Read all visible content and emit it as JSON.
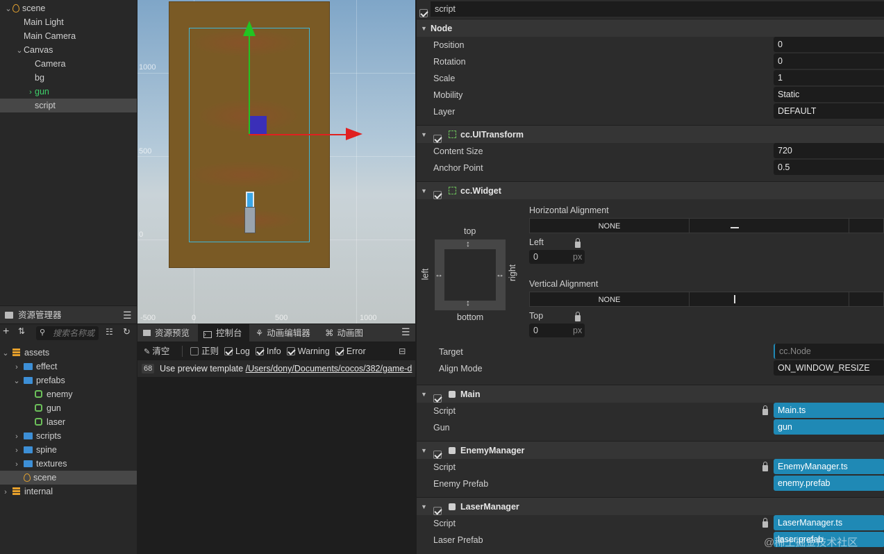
{
  "hierarchy": {
    "items": [
      {
        "label": "scene",
        "indent": 0,
        "arrow": "⌄",
        "icon": "fire"
      },
      {
        "label": "Main Light",
        "indent": 1,
        "arrow": "",
        "icon": ""
      },
      {
        "label": "Main Camera",
        "indent": 1,
        "arrow": "",
        "icon": ""
      },
      {
        "label": "Canvas",
        "indent": 1,
        "arrow": "⌄",
        "icon": ""
      },
      {
        "label": "Camera",
        "indent": 2,
        "arrow": "",
        "icon": ""
      },
      {
        "label": "bg",
        "indent": 2,
        "arrow": "",
        "icon": ""
      },
      {
        "label": "gun",
        "indent": 2,
        "arrow": "›",
        "icon": "",
        "color": "#3fcf6a"
      },
      {
        "label": "script",
        "indent": 2,
        "arrow": "",
        "icon": "",
        "selected": true
      }
    ]
  },
  "scene": {
    "ruler_left": [
      "1000",
      "500",
      "0"
    ],
    "ruler_bottom": [
      "-500",
      "0",
      "500",
      "1000"
    ]
  },
  "assets": {
    "title": "资源管理器",
    "search_placeholder": "搜索名称或",
    "items": [
      {
        "label": "assets",
        "indent": 0,
        "arrow": "⌄",
        "icon": "db"
      },
      {
        "label": "effect",
        "indent": 1,
        "arrow": "›",
        "icon": "folder"
      },
      {
        "label": "prefabs",
        "indent": 1,
        "arrow": "⌄",
        "icon": "folder"
      },
      {
        "label": "enemy",
        "indent": 2,
        "arrow": "",
        "icon": "prefab"
      },
      {
        "label": "gun",
        "indent": 2,
        "arrow": "",
        "icon": "prefab"
      },
      {
        "label": "laser",
        "indent": 2,
        "arrow": "",
        "icon": "prefab"
      },
      {
        "label": "scripts",
        "indent": 1,
        "arrow": "›",
        "icon": "folder"
      },
      {
        "label": "spine",
        "indent": 1,
        "arrow": "›",
        "icon": "folder"
      },
      {
        "label": "textures",
        "indent": 1,
        "arrow": "›",
        "icon": "folder"
      },
      {
        "label": "scene",
        "indent": 1,
        "arrow": "",
        "icon": "fire",
        "selected": true
      },
      {
        "label": "internal",
        "indent": 0,
        "arrow": "›",
        "icon": "db"
      }
    ]
  },
  "console": {
    "tabs": [
      "资源预览",
      "控制台",
      "动画编辑器",
      "动画图"
    ],
    "active_tab": "控制台",
    "clear": "清空",
    "filters": [
      {
        "label": "正则",
        "checked": false
      },
      {
        "label": "Log",
        "checked": true
      },
      {
        "label": "Info",
        "checked": true
      },
      {
        "label": "Warning",
        "checked": true
      },
      {
        "label": "Error",
        "checked": true
      }
    ],
    "log_count": "68",
    "log_text": "Use preview template ",
    "log_path": "/Users/dony/Documents/cocos/382/game-d"
  },
  "inspector": {
    "node_name": "script",
    "node_section": "Node",
    "node_props": [
      {
        "label": "Position",
        "value": "0"
      },
      {
        "label": "Rotation",
        "value": "0"
      },
      {
        "label": "Scale",
        "value": "1"
      },
      {
        "label": "Mobility",
        "value": "Static"
      },
      {
        "label": "Layer",
        "value": "DEFAULT"
      }
    ],
    "uitransform": {
      "title": "cc.UITransform",
      "props": [
        {
          "label": "Content Size",
          "value": "720"
        },
        {
          "label": "Anchor Point",
          "value": "0.5"
        }
      ]
    },
    "widget": {
      "title": "cc.Widget",
      "h_align_label": "Horizontal Alignment",
      "h_align_value": "NONE",
      "left_label": "Left",
      "left_value": "0",
      "v_align_label": "Vertical Alignment",
      "v_align_value": "NONE",
      "top_label": "Top",
      "top_value": "0",
      "unit": "px",
      "box_top": "top",
      "box_bottom": "bottom",
      "box_left": "left",
      "box_right": "right",
      "target_label": "Target",
      "target_value": "cc.Node",
      "align_mode_label": "Align Mode",
      "align_mode_value": "ON_WINDOW_RESIZE"
    },
    "main": {
      "title": "Main",
      "script_label": "Script",
      "script_value": "Main.ts",
      "gun_label": "Gun",
      "gun_value": "gun"
    },
    "enemy_manager": {
      "title": "EnemyManager",
      "script_label": "Script",
      "script_value": "EnemyManager.ts",
      "prefab_label": "Enemy Prefab",
      "prefab_value": "enemy.prefab"
    },
    "laser_manager": {
      "title": "LaserManager",
      "script_label": "Script",
      "script_value": "LaserManager.ts",
      "prefab_label": "Laser Prefab",
      "prefab_value": "laser.prefab"
    }
  },
  "watermark": "@稀土掘金技术社区"
}
